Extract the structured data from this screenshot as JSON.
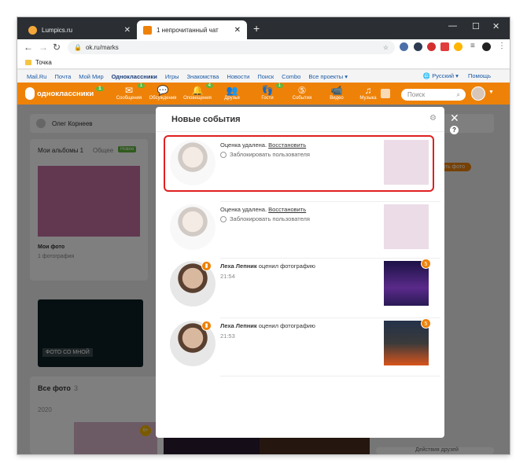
{
  "browser": {
    "tabs": [
      {
        "title": "Lumpics.ru",
        "favicon_color": "#f4a83a"
      },
      {
        "title": "1 непрочитанный чат",
        "favicon_color": "#ee8208"
      }
    ],
    "new_tab": "+",
    "close": "✕",
    "window_controls": [
      "—",
      "☐",
      "✕"
    ],
    "url": "ok.ru/marks",
    "bookmark": "Точка"
  },
  "mailbar": {
    "links": [
      "Mail.Ru",
      "Почта",
      "Мой Мир",
      "Одноклассники",
      "Игры",
      "Знакомства",
      "Новости",
      "Поиск",
      "Combo",
      "Все проекты ▾"
    ],
    "right": [
      "🌐 Русский ▾",
      "Помощь"
    ]
  },
  "ok": {
    "logo": "одноклассники",
    "logo_badge": "1",
    "nav": [
      {
        "label": "Сообщения",
        "icon": "✉",
        "badge": "1"
      },
      {
        "label": "Обсуждения",
        "icon": "💬",
        "badge": ""
      },
      {
        "label": "Оповещения",
        "icon": "🔔",
        "badge": "4"
      },
      {
        "label": "Друзья",
        "icon": "👥",
        "badge": ""
      },
      {
        "label": "Гости",
        "icon": "👣",
        "badge": "1"
      },
      {
        "label": "События",
        "icon": "⑤",
        "badge": ""
      },
      {
        "label": "Видео",
        "icon": "📹",
        "badge": ""
      },
      {
        "label": "Музыка",
        "icon": "♫",
        "badge": ""
      }
    ],
    "search_placeholder": "Поиск"
  },
  "background": {
    "user_name": "Олег Корнеев",
    "albums_tab": "Мои альбомы 1",
    "general_tab": "Общее",
    "new_badge": "Новое",
    "my_photos": "Мои фото",
    "photos_count": "1 фотография",
    "photo_with_me": "ФОТО СО МНОЙ",
    "all_photos": "Все фото",
    "all_photos_count": "3",
    "year": "2020",
    "add_photo": "ать фото",
    "friends_actions": "Действия друзей",
    "age_badge": "6+"
  },
  "modal": {
    "title": "Новые события",
    "close": "✕",
    "help": "?",
    "events": [
      {
        "type": "removed",
        "text": "Оценка удалена.",
        "restore": "Восстановить",
        "block": "Заблокировать пользователя"
      },
      {
        "type": "removed",
        "text": "Оценка удалена.",
        "restore": "Восстановить",
        "block": "Заблокировать пользователя"
      },
      {
        "type": "rating",
        "name": "Леха Лепник",
        "action": "оценил фотографию",
        "time": "21:54",
        "score": "5"
      },
      {
        "type": "rating",
        "name": "Леха Лепник",
        "action": "оценил фотографию",
        "time": "21:53",
        "score": "5"
      }
    ]
  },
  "colors": {
    "ok_orange": "#ee8208",
    "highlight": "#e02020",
    "badge_green": "#5fb63a"
  }
}
